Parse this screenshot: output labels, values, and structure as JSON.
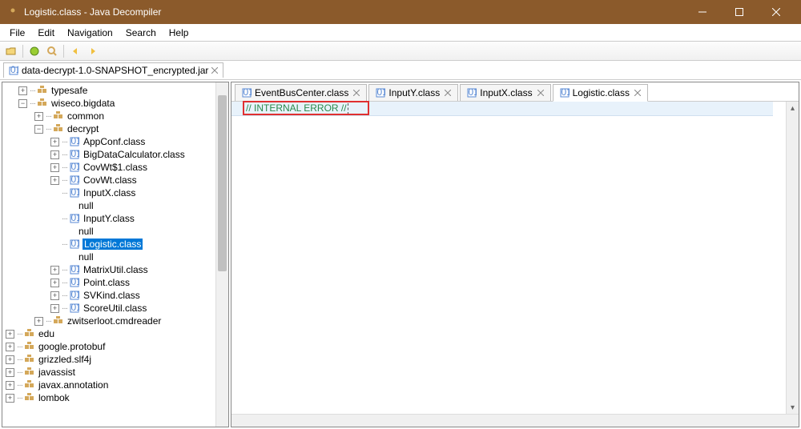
{
  "titlebar": {
    "title": "Logistic.class - Java Decompiler"
  },
  "menu": {
    "file": "File",
    "edit": "Edit",
    "navigation": "Navigation",
    "search": "Search",
    "help": "Help"
  },
  "jar": {
    "name": "data-decrypt-1.0-SNAPSHOT_encrypted.jar"
  },
  "tree": {
    "typesafe": "typesafe",
    "wiseco": "wiseco.bigdata",
    "common": "common",
    "decrypt": "decrypt",
    "appconf": "AppConf.class",
    "bigdata": "BigDataCalculator.class",
    "covwt1": "CovWt$1.class",
    "covwt": "CovWt.class",
    "inputx": "InputX.class",
    "null1": "null",
    "inputy": "InputY.class",
    "null2": "null",
    "logistic": "Logistic.class",
    "null3": "null",
    "matrixutil": "MatrixUtil.class",
    "point": "Point.class",
    "svkind": "SVKind.class",
    "scoreutil": "ScoreUtil.class",
    "zwitserloot": "zwitserloot.cmdreader",
    "edu": "edu",
    "protobuf": "google.protobuf",
    "grizzled": "grizzled.slf4j",
    "javassist": "javassist",
    "javax": "javax.annotation",
    "lombok": "lombok"
  },
  "tabs": {
    "t1": "EventBusCenter.class",
    "t2": "InputY.class",
    "t3": "InputX.class",
    "t4": "Logistic.class"
  },
  "editor": {
    "line1": "// INTERNAL ERROR //"
  }
}
